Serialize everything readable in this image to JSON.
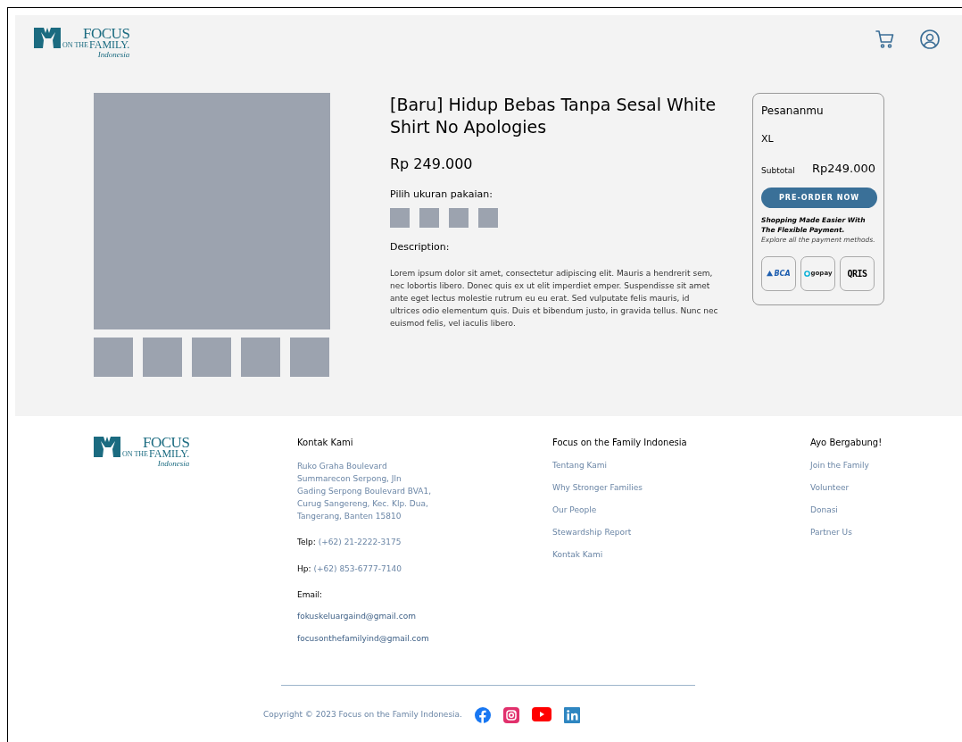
{
  "header": {
    "logo": {
      "word1": "FOCUS",
      "small": "ON THE",
      "word2": "FAMILY.",
      "sub": "Indonesia"
    }
  },
  "product": {
    "gallery": {
      "main": {
        "kind": "placeholder"
      },
      "thumbnails": [
        {
          "kind": "placeholder"
        },
        {
          "kind": "placeholder"
        },
        {
          "kind": "placeholder"
        },
        {
          "kind": "placeholder"
        },
        {
          "kind": "placeholder"
        }
      ]
    },
    "title": "[Baru] Hidup Bebas Tanpa Sesal White Shirt No Apologies",
    "price": "Rp 249.000",
    "size_label": "Pilih ukuran pakaian:",
    "sizes": [
      {
        "selected": false
      },
      {
        "selected": false
      },
      {
        "selected": false
      },
      {
        "selected": false
      }
    ],
    "description_label": "Description:",
    "description": "Lorem ipsum dolor sit amet, consectetur adipiscing elit. Mauris a hendrerit sem, nec lobortis libero. Donec quis ex ut elit imperdiet emper. Suspendisse sit amet ante eget lectus molestie rutrum eu eu erat. Sed vulputate felis mauris, id ultrices odio elementum quis. Duis et bibendum justo, in gravida tellus. Nunc nec euismod felis, vel iaculis libero."
  },
  "order": {
    "title": "Pesananmu",
    "size": "XL",
    "subtotal_label": "Subtotal",
    "subtotal": "Rp249.000",
    "button": "PRE-ORDER NOW",
    "note_bold": "Shopping Made Easier With The Flexible Payment.",
    "note": "Explore all the payment methods.",
    "payments": [
      {
        "kind": "bca",
        "label": "BCA"
      },
      {
        "kind": "gopay",
        "label": "gopay"
      },
      {
        "kind": "qris",
        "label": "QRIS"
      }
    ]
  },
  "footer": {
    "logo": {
      "word1": "FOCUS",
      "small": "ON THE",
      "word2": "FAMILY.",
      "sub": "Indonesia"
    },
    "contact": {
      "title": "Kontak Kami",
      "address": [
        "Ruko Graha Boulevard",
        "Summarecon Serpong, Jln",
        "Gading Serpong Boulevard BVA1,",
        "Curug Sangereng, Kec. Klp. Dua,",
        "Tangerang, Banten 15810"
      ],
      "phones": [
        {
          "label": "Telp:",
          "value": "(+62) 21-2222-3175"
        },
        {
          "label": "Hp:",
          "value": "(+62) 853-6777-7140"
        }
      ],
      "email_label": "Email:",
      "emails": [
        "fokuskeluargaind@gmail.com",
        "focusonthefamilyind@gmail.com"
      ]
    },
    "columns": [
      {
        "title": "Focus on the Family Indonesia",
        "links": [
          "Tentang Kami",
          "Why Stronger Families",
          "Our People",
          "Stewardship Report",
          "Kontak Kami"
        ]
      },
      {
        "title": "Ayo Bergabung!",
        "links": [
          "Join the Family",
          "Volunteer",
          "Donasi",
          "Partner Us"
        ]
      }
    ],
    "copyright": "Copyright © 2023 Focus on the Family Indonesia.",
    "socials": [
      {
        "kind": "facebook"
      },
      {
        "kind": "instagram"
      },
      {
        "kind": "youtube"
      },
      {
        "kind": "linkedin"
      }
    ]
  }
}
